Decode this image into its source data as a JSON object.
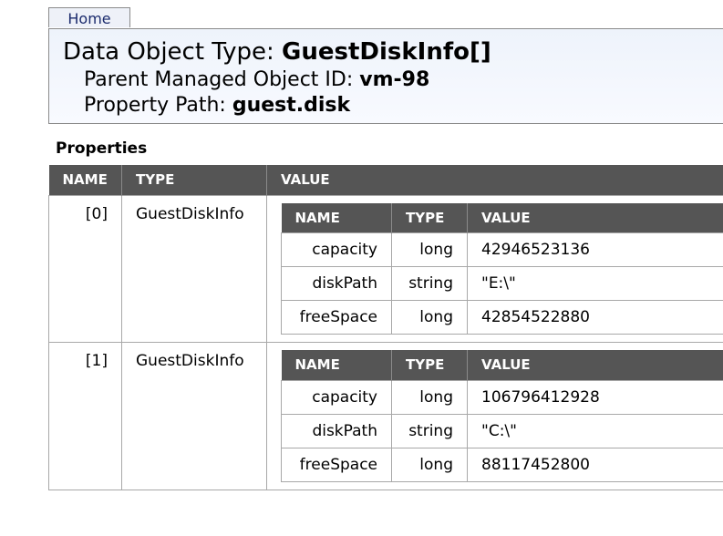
{
  "nav": {
    "home_label": "Home"
  },
  "header": {
    "type_label": "Data Object Type: ",
    "type_value": "GuestDiskInfo[]",
    "parent_label": "Parent Managed Object ID: ",
    "parent_value": "vm-98",
    "path_label": "Property Path: ",
    "path_value": "guest.disk"
  },
  "properties": {
    "title": "Properties",
    "columns": [
      "NAME",
      "TYPE",
      "VALUE"
    ],
    "rows": [
      {
        "name": "[0]",
        "type": "GuestDiskInfo",
        "inner": {
          "columns": [
            "NAME",
            "TYPE",
            "VALUE"
          ],
          "rows": [
            {
              "name": "capacity",
              "type": "long",
              "value": "42946523136"
            },
            {
              "name": "diskPath",
              "type": "string",
              "value": "\"E:\\\""
            },
            {
              "name": "freeSpace",
              "type": "long",
              "value": "42854522880"
            }
          ]
        }
      },
      {
        "name": "[1]",
        "type": "GuestDiskInfo",
        "inner": {
          "columns": [
            "NAME",
            "TYPE",
            "VALUE"
          ],
          "rows": [
            {
              "name": "capacity",
              "type": "long",
              "value": "106796412928"
            },
            {
              "name": "diskPath",
              "type": "string",
              "value": "\"C:\\\""
            },
            {
              "name": "freeSpace",
              "type": "long",
              "value": "88117452800"
            }
          ]
        }
      }
    ]
  }
}
